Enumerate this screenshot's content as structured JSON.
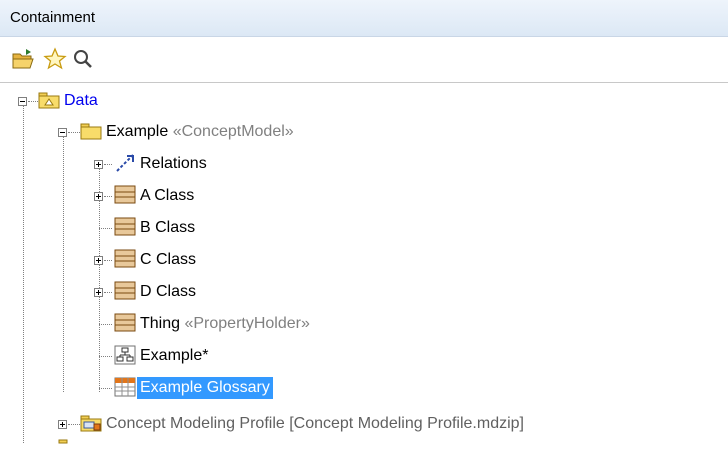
{
  "panel": {
    "title": "Containment"
  },
  "toolbar": {
    "open_icon": "folder-open-icon",
    "favorite_icon": "star-icon",
    "search_icon": "search-icon"
  },
  "tree": {
    "root": {
      "label": "Data"
    },
    "example": {
      "label": "Example",
      "stereotype": "«ConceptModel»"
    },
    "relations": {
      "label": "Relations"
    },
    "a_class": {
      "label": "A Class"
    },
    "b_class": {
      "label": "B Class"
    },
    "c_class": {
      "label": "C Class"
    },
    "d_class": {
      "label": "D Class"
    },
    "thing": {
      "label": "Thing",
      "stereotype": "«PropertyHolder»"
    },
    "diagram": {
      "label": "Example*"
    },
    "glossary": {
      "label": "Example Glossary"
    },
    "profile": {
      "label": "Concept Modeling Profile [Concept Modeling Profile.mdzip]"
    }
  },
  "colors": {
    "selection": "#3399ff",
    "link": "#0000ee",
    "stereotype": "#808080",
    "class_icon": "#e8c89a"
  }
}
